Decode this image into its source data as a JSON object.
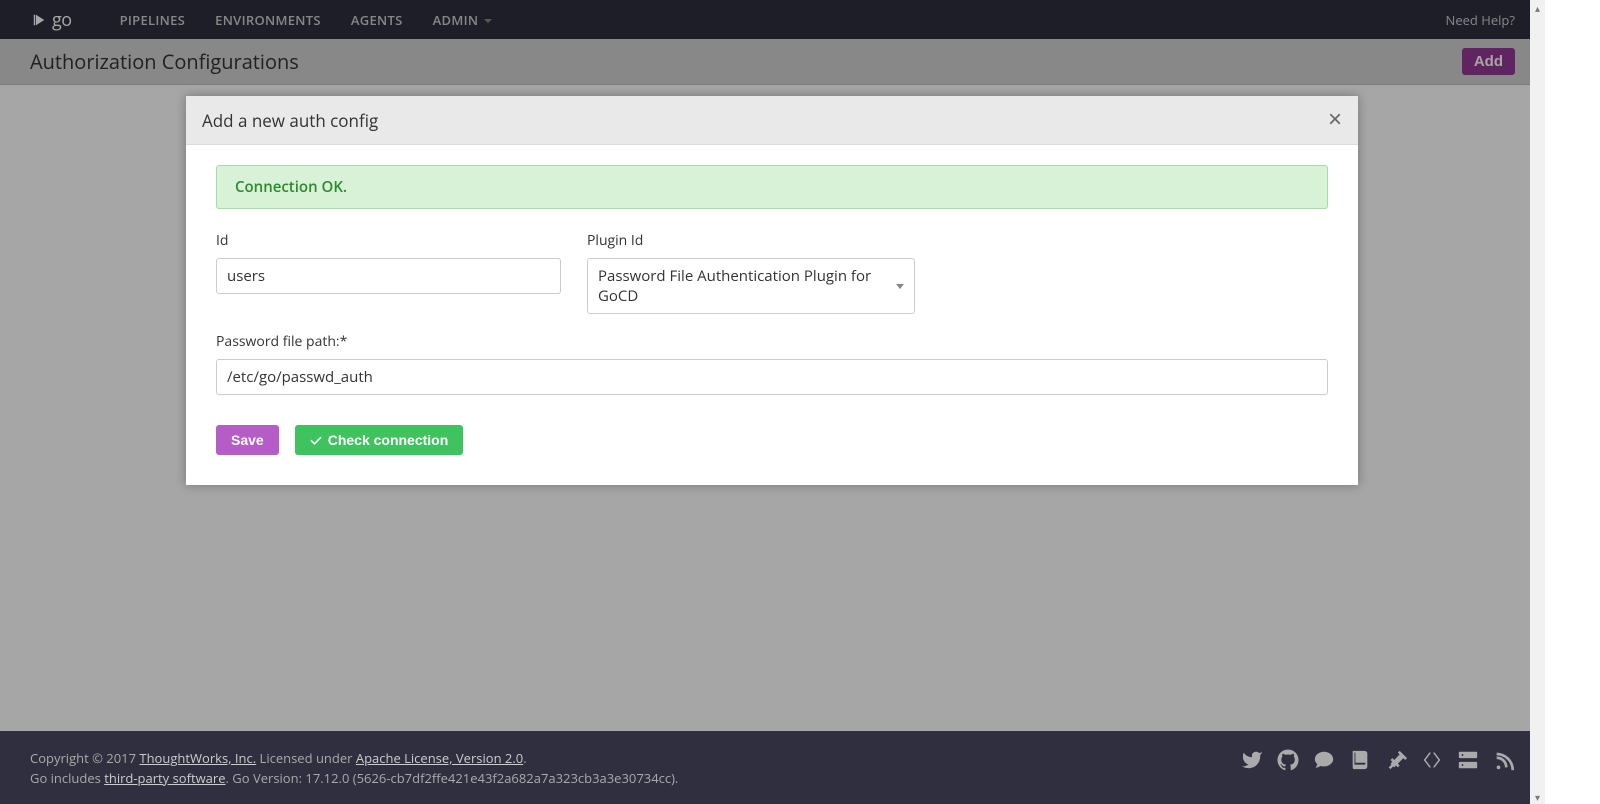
{
  "nav": {
    "logo_text": "go",
    "items": [
      "PIPELINES",
      "ENVIRONMENTS",
      "AGENTS",
      "ADMIN"
    ],
    "help": "Need Help?"
  },
  "page": {
    "title": "Authorization Configurations",
    "add_label": "Add"
  },
  "modal": {
    "title": "Add a new auth config",
    "alert": "Connection OK.",
    "id_label": "Id",
    "id_value": "users",
    "plugin_label": "Plugin Id",
    "plugin_value": "Password File Authentication Plugin for GoCD",
    "path_label": "Password file path:*",
    "path_value": "/etc/go/passwd_auth",
    "save_label": "Save",
    "check_label": "Check connection"
  },
  "footer": {
    "copyright_prefix": "Copyright © 2017 ",
    "tw_link": "ThoughtWorks, Inc.",
    "licensed": " Licensed under ",
    "apache_link": "Apache License, Version 2.0",
    "period1": ".",
    "go_includes": "Go includes ",
    "third_party": "third-party software",
    "version": ". Go Version: 17.12.0 (5626-cb7df2ffe421e43f2a682a7a323cb3a3e30734cc)."
  }
}
